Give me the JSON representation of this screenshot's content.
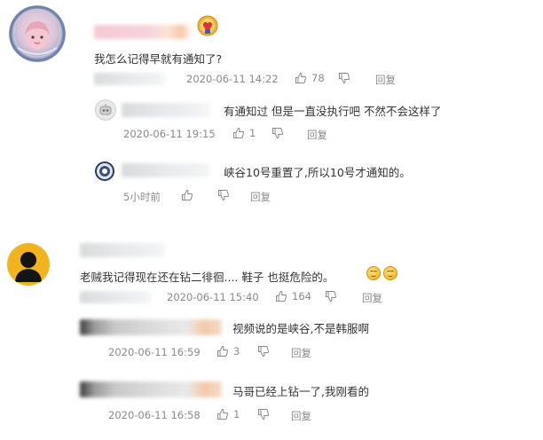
{
  "comments": [
    {
      "text": "我怎么记得早就有通知了?",
      "timestamp": "2020-06-11 14:22",
      "likes": "78",
      "reply_label": "回复",
      "replies": [
        {
          "text": "有通知过 但是一直没执行吧 不然不会这样了",
          "timestamp": "2020-06-11 19:15",
          "likes": "1",
          "reply_label": "回复"
        },
        {
          "text": "峡谷10号重置了,所以10号才通知的。",
          "timestamp": "5小时前",
          "reply_label": "回复"
        }
      ]
    },
    {
      "text": "老贼我记得现在还在钻二徘徊.... 鞋子 也挺危险的。",
      "timestamp": "2020-06-11 15:40",
      "likes": "164",
      "reply_label": "回复",
      "replies": [
        {
          "text": "视频说的是峡谷,不是韩服啊",
          "timestamp": "2020-06-11 16:59",
          "likes": "3",
          "reply_label": "回复"
        },
        {
          "text": "马哥已经上钻一了,我刚看的",
          "timestamp": "2020-06-11 16:58",
          "likes": "1",
          "reply_label": "回复"
        }
      ]
    }
  ],
  "colors": {
    "text": "#333333",
    "meta": "#8a8a8a",
    "background": "#ffffff"
  },
  "icons": {
    "like": "thumbs-up-icon",
    "dislike": "thumbs-down-icon",
    "emoji": "grin-emoji-icon",
    "badge": "heart-badge-icon"
  }
}
